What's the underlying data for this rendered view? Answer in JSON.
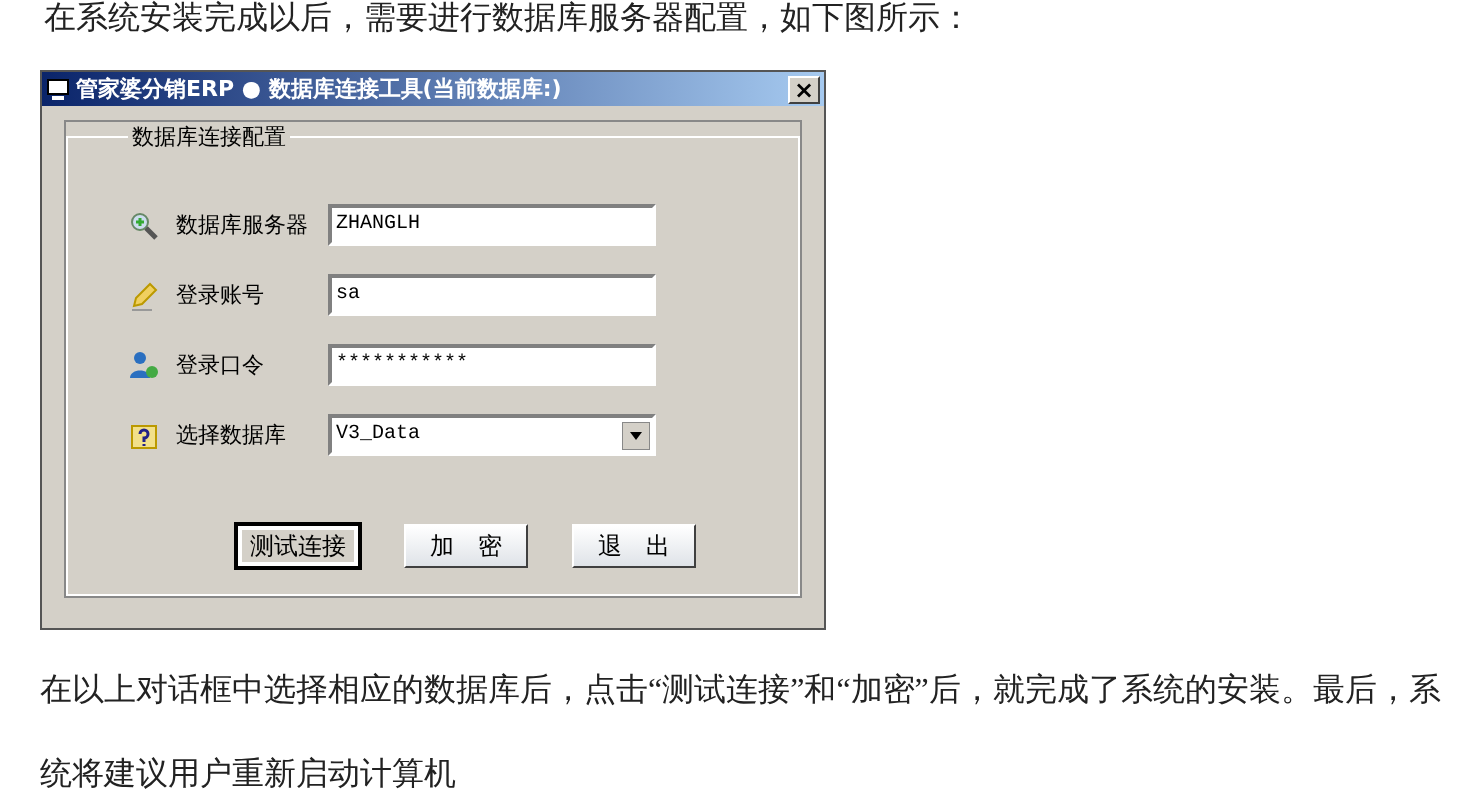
{
  "intro": "在系统安装完成以后，需要进行数据库服务器配置，如下图所示：",
  "dialog": {
    "title": "管家婆分销ERP ● 数据库连接工具(当前数据库:)",
    "close": "×",
    "group_title": "数据库连接配置",
    "fields": [
      {
        "label": "数据库服务器",
        "value": "ZHANGLH",
        "kind": "text"
      },
      {
        "label": "登录账号",
        "value": "sa",
        "kind": "text"
      },
      {
        "label": "登录口令",
        "value": "***********",
        "kind": "text"
      },
      {
        "label": "选择数据库",
        "value": "V3_Data",
        "kind": "select"
      }
    ],
    "buttons": [
      {
        "label": "测试连接",
        "focused": true
      },
      {
        "label": "加　密",
        "focused": false
      },
      {
        "label": "退　出",
        "focused": false
      }
    ]
  },
  "paragraph": "在以上对话框中选择相应的数据库后，点击“测试连接”和“加密”后，就完成了系统的安装。最后，系统将建议用户重新启动计算机"
}
